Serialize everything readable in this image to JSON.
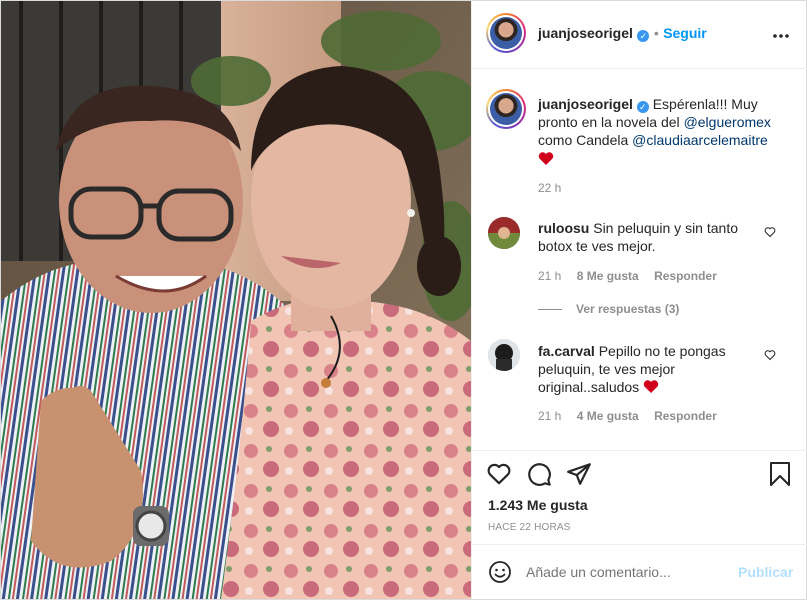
{
  "header": {
    "username": "juanjoseorigel",
    "separator": "•",
    "follow_label": "Seguir",
    "more_icon": "more-dots-icon"
  },
  "caption": {
    "username": "juanjoseorigel",
    "line1": "Espérenla!!! Muy",
    "line2_pre": "pronto en la novela del ",
    "mention1": "@elgueromex",
    "line3_pre": "como Candela ",
    "mention2": "@claudiaarcelemaitre",
    "emoji": "heart-emoji",
    "time": "22 h"
  },
  "comments": [
    {
      "username": "ruloosu",
      "text_line1": "Sin peluquin y sin tanto",
      "text_line2": "botox te ves mejor.",
      "time": "21 h",
      "likes": "8 Me gusta",
      "reply_label": "Responder",
      "view_replies": "Ver respuestas (3)"
    },
    {
      "username": "fa.carval",
      "text_line1": "Pepillo no te pongas",
      "text_line2": "peluquin, te ves mejor",
      "text_line3": "original..saludos",
      "time": "21 h",
      "likes": "4 Me gusta",
      "reply_label": "Responder"
    }
  ],
  "actions": {
    "likes_count": "1.243 Me gusta",
    "post_age": "HACE 22 HORAS"
  },
  "add_comment": {
    "placeholder": "Añade un comentario...",
    "publish_label": "Publicar"
  },
  "colors": {
    "accent": "#0095f6",
    "heart": "#ed4956",
    "verified": "#3897f0"
  }
}
